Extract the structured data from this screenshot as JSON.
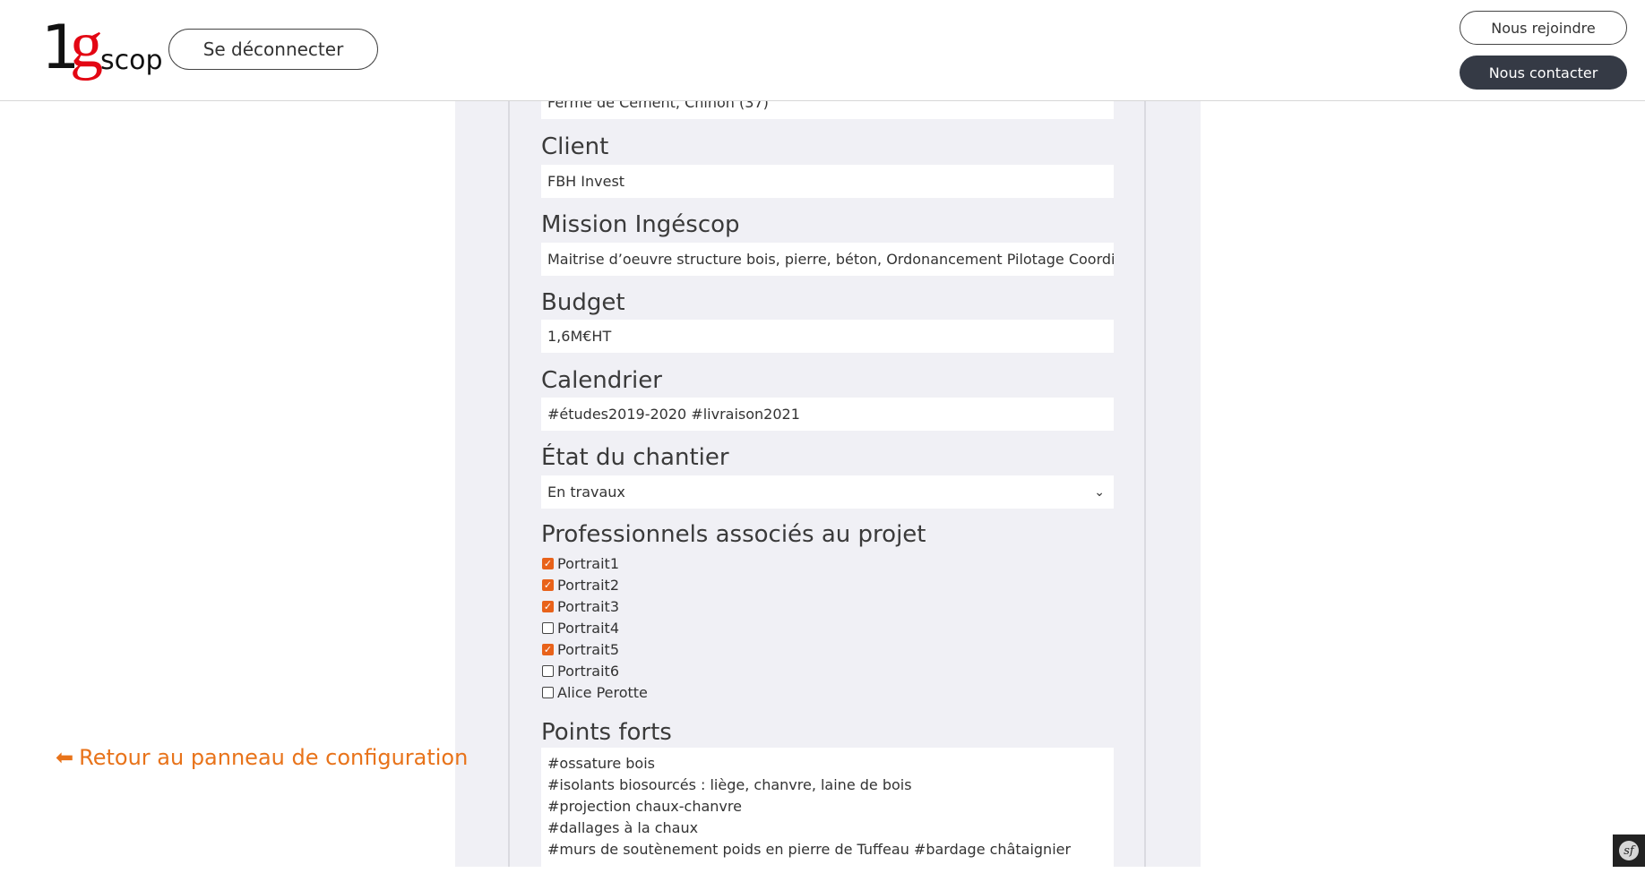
{
  "header": {
    "logo_one": "1",
    "logo_g": "g",
    "logo_scop": "scop",
    "logout_label": "Se déconnecter",
    "join_label": "Nous rejoindre",
    "contact_label": "Nous contacter"
  },
  "back_link": {
    "arrow": "⬅",
    "label": "Retour au panneau de configuration"
  },
  "form": {
    "location_value": "Ferme de Cément, Chinon (37)",
    "client": {
      "label": "Client",
      "value": "FBH Invest"
    },
    "mission": {
      "label": "Mission Ingéscop",
      "value": "Maitrise d’oeuvre structure bois, pierre, béton, Ordonancement Pilotage Coordination"
    },
    "budget": {
      "label": "Budget",
      "value": "1,6M€HT"
    },
    "calendrier": {
      "label": "Calendrier",
      "value": "#études2019-2020 #livraison2021"
    },
    "etat": {
      "label": "État du chantier",
      "selected": "En travaux"
    },
    "professionnels": {
      "label": "Professionnels associés au projet",
      "items": [
        {
          "label": "Portrait1",
          "checked": true
        },
        {
          "label": "Portrait2",
          "checked": true
        },
        {
          "label": "Portrait3",
          "checked": true
        },
        {
          "label": "Portrait4",
          "checked": false
        },
        {
          "label": "Portrait5",
          "checked": true
        },
        {
          "label": "Portrait6",
          "checked": false
        },
        {
          "label": "Alice Perotte",
          "checked": false
        }
      ]
    },
    "points_forts": {
      "label": "Points forts",
      "lines": [
        "#ossature bois",
        "#isolants biosourcés : liège, chanvre, laine de bois",
        "#projection chaux-chanvre",
        "#dallages à la chaux",
        "#murs de soutènement poids en pierre de Tuffeau #bardage châtaignier"
      ]
    }
  },
  "colors": {
    "accent": "#e8731a",
    "checkbox_checked": "#e8621a",
    "logo_red": "#e30613",
    "dark_button": "#353a45",
    "column_bg": "#f0f0f5"
  },
  "icons": {
    "chevron": "chevron-down-icon",
    "arrow": "arrow-left-icon",
    "check": "checkmark-icon",
    "symfony": "symfony-icon"
  }
}
